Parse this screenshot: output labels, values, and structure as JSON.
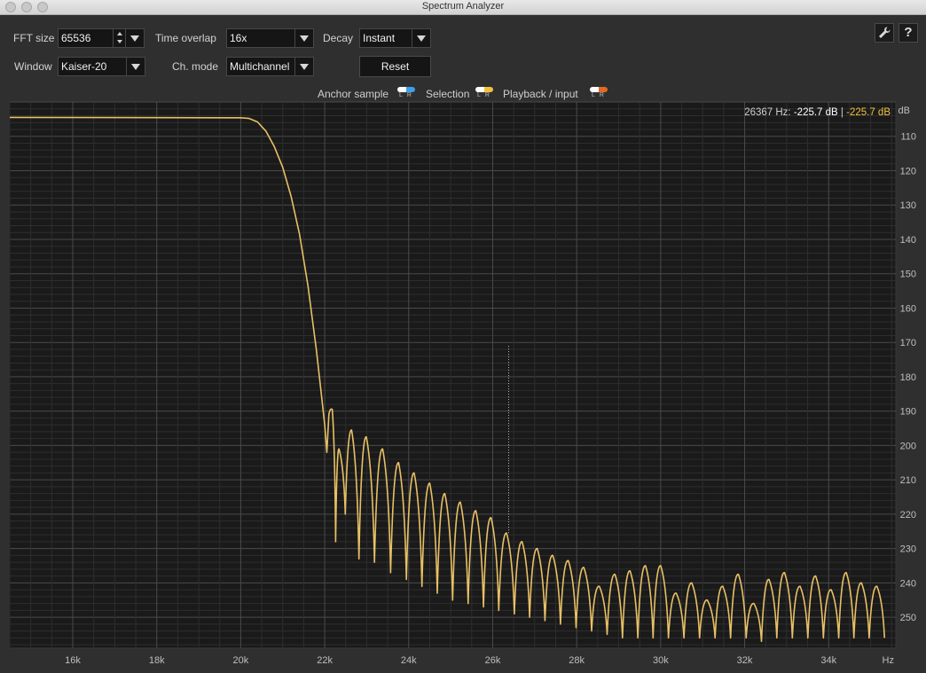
{
  "window": {
    "title": "Spectrum Analyzer"
  },
  "controls": {
    "fft_size": {
      "label": "FFT size",
      "value": "65536"
    },
    "time_overlap": {
      "label": "Time overlap",
      "value": "16x"
    },
    "decay": {
      "label": "Decay",
      "value": "Instant"
    },
    "window_fn": {
      "label": "Window",
      "value": "Kaiser-20"
    },
    "ch_mode": {
      "label": "Ch. mode",
      "value": "Multichannel"
    },
    "reset_label": "Reset",
    "settings_icon": "wrench-icon",
    "help_icon": "help-icon",
    "help_glyph": "?"
  },
  "legend": [
    {
      "label": "Anchor sample",
      "right_color": "#3aa0e8",
      "letters": "LR"
    },
    {
      "label": "Selection",
      "right_color": "#f0c040",
      "letters": "LR"
    },
    {
      "label": "Playback / input",
      "right_color": "#e06a20",
      "letters": "LR"
    }
  ],
  "readout": {
    "freq": "26367 Hz:",
    "left_db": "-225.7 dB",
    "sep": "|",
    "right_db": "-225.7 dB"
  },
  "colors": {
    "trace": "#e8c065",
    "readout_right": "#f0c040",
    "plot_bg": "#1a1a1a"
  },
  "chart_data": {
    "type": "line",
    "xlim": [
      14500,
      35600
    ],
    "ylim": [
      -259,
      -100
    ],
    "x_ticks": [
      {
        "value": 16000,
        "label": "16k"
      },
      {
        "value": 18000,
        "label": "18k"
      },
      {
        "value": 20000,
        "label": "20k"
      },
      {
        "value": 22000,
        "label": "22k"
      },
      {
        "value": 24000,
        "label": "24k"
      },
      {
        "value": 26000,
        "label": "26k"
      },
      {
        "value": 28000,
        "label": "28k"
      },
      {
        "value": 30000,
        "label": "30k"
      },
      {
        "value": 32000,
        "label": "32k"
      },
      {
        "value": 34000,
        "label": "34k"
      }
    ],
    "x_unit_label": "Hz",
    "y_ticks": [
      {
        "value": -110,
        "label": "110"
      },
      {
        "value": -120,
        "label": "120"
      },
      {
        "value": -130,
        "label": "130"
      },
      {
        "value": -140,
        "label": "140"
      },
      {
        "value": -150,
        "label": "150"
      },
      {
        "value": -160,
        "label": "160"
      },
      {
        "value": -170,
        "label": "170"
      },
      {
        "value": -180,
        "label": "180"
      },
      {
        "value": -190,
        "label": "190"
      },
      {
        "value": -200,
        "label": "200"
      },
      {
        "value": -210,
        "label": "210"
      },
      {
        "value": -220,
        "label": "220"
      },
      {
        "value": -230,
        "label": "230"
      },
      {
        "value": -240,
        "label": "240"
      },
      {
        "value": -250,
        "label": "250"
      }
    ],
    "y_unit_label": "dB",
    "cursor_freq": 26367,
    "cursor_db": -225.7,
    "series": [
      {
        "flat_db": -104.5,
        "points": [
          [
            20000,
            -104.6
          ],
          [
            20200,
            -104.8
          ],
          [
            20400,
            -105.8
          ],
          [
            20600,
            -108.5
          ],
          [
            20800,
            -113
          ],
          [
            21000,
            -119
          ],
          [
            21200,
            -127.5
          ],
          [
            21400,
            -138.5
          ],
          [
            21600,
            -153.5
          ],
          [
            21800,
            -172
          ],
          [
            21900,
            -183
          ],
          [
            22000,
            -194
          ],
          [
            22050,
            -202
          ],
          [
            22100,
            -191
          ]
        ],
        "side_lobes": [
          {
            "x": 22180,
            "peak": -189.5,
            "null": -228
          },
          {
            "x": 22340,
            "peak": -201,
            "null": -220
          },
          {
            "x": 22640,
            "peak": -195.5,
            "null": -233
          },
          {
            "x": 22990,
            "peak": -197.5,
            "null": -234
          },
          {
            "x": 23380,
            "peak": -201,
            "null": -237
          },
          {
            "x": 23760,
            "peak": -205,
            "null": -239
          },
          {
            "x": 24130,
            "peak": -208,
            "null": -241
          },
          {
            "x": 24500,
            "peak": -211,
            "null": -243
          },
          {
            "x": 24860,
            "peak": -214,
            "null": -245
          },
          {
            "x": 25230,
            "peak": -216.5,
            "null": -246
          },
          {
            "x": 25600,
            "peak": -219,
            "null": -247
          },
          {
            "x": 25960,
            "peak": -221,
            "null": -248
          },
          {
            "x": 26330,
            "peak": -225.5,
            "null": -249
          },
          {
            "x": 26700,
            "peak": -228,
            "null": -250
          },
          {
            "x": 27060,
            "peak": -230,
            "null": -251
          },
          {
            "x": 27430,
            "peak": -232,
            "null": -252
          },
          {
            "x": 27800,
            "peak": -233.5,
            "null": -253
          },
          {
            "x": 28170,
            "peak": -235.5,
            "null": -254
          },
          {
            "x": 28540,
            "peak": -241,
            "null": -255
          },
          {
            "x": 28910,
            "peak": -237.5,
            "null": -256
          },
          {
            "x": 29270,
            "peak": -236.5,
            "null": -256
          },
          {
            "x": 29640,
            "peak": -235,
            "null": -256
          },
          {
            "x": 30000,
            "peak": -235,
            "null": -256
          },
          {
            "x": 30370,
            "peak": -243,
            "null": -256
          },
          {
            "x": 30740,
            "peak": -240,
            "null": -256
          },
          {
            "x": 31110,
            "peak": -245,
            "null": -256
          },
          {
            "x": 31480,
            "peak": -241,
            "null": -256
          },
          {
            "x": 31850,
            "peak": -237.5,
            "null": -256
          },
          {
            "x": 32220,
            "peak": -246,
            "null": -257
          },
          {
            "x": 32580,
            "peak": -239,
            "null": -256
          },
          {
            "x": 32950,
            "peak": -237,
            "null": -256
          },
          {
            "x": 33320,
            "peak": -241,
            "null": -256
          },
          {
            "x": 33690,
            "peak": -238,
            "null": -256
          },
          {
            "x": 34060,
            "peak": -242,
            "null": -256
          },
          {
            "x": 34420,
            "peak": -237,
            "null": -256
          },
          {
            "x": 34780,
            "peak": -240,
            "null": -256
          },
          {
            "x": 35150,
            "peak": -241,
            "null": -256
          }
        ]
      }
    ]
  }
}
